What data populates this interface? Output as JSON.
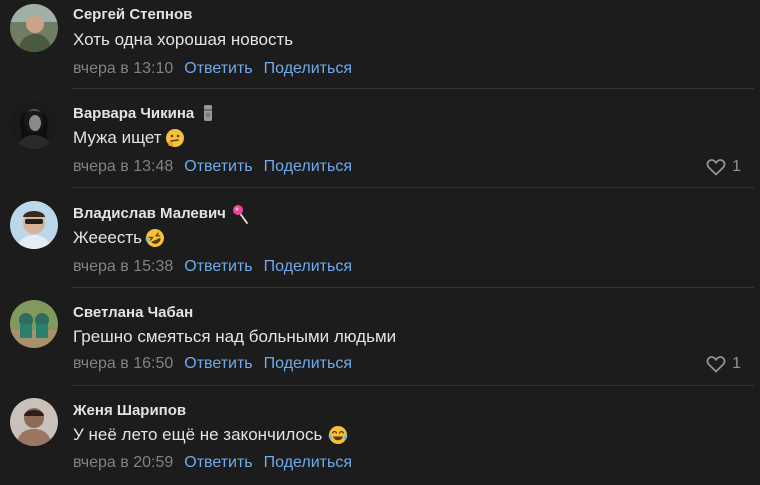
{
  "comments": [
    {
      "author": "Сергей Степнов",
      "text": "Хоть одна хорошая новость",
      "emoji": "",
      "badge": "",
      "date": "вчера в 13:10",
      "reply": "Ответить",
      "share": "Поделиться",
      "likes": ""
    },
    {
      "author": "Варвара Чикина",
      "text": "Мужа ищет",
      "emoji": "thinking-face",
      "badge": "moai-statue",
      "date": "вчера в 13:48",
      "reply": "Ответить",
      "share": "Поделиться",
      "likes": "1"
    },
    {
      "author": "Владислав Малевич",
      "text": "Жееесть",
      "emoji": "rofl-face",
      "badge": "lollipop",
      "date": "вчера в 15:38",
      "reply": "Ответить",
      "share": "Поделиться",
      "likes": ""
    },
    {
      "author": "Светлана Чабан",
      "text": "Грешно смеяться над больными людьми",
      "emoji": "",
      "badge": "",
      "date": "вчера в 16:50",
      "reply": "Ответить",
      "share": "Поделиться",
      "likes": "1"
    },
    {
      "author": "Женя Шарипов",
      "text": "У неё лето ещё не закончилось",
      "emoji": "tears-of-joy-face",
      "badge": "",
      "date": "вчера в 20:59",
      "reply": "Ответить",
      "share": "Поделиться",
      "likes": ""
    }
  ],
  "colors": {
    "background": "#1c1c1d",
    "text": "#e1e3e6",
    "meta": "#828282",
    "link": "#71aaeb"
  }
}
